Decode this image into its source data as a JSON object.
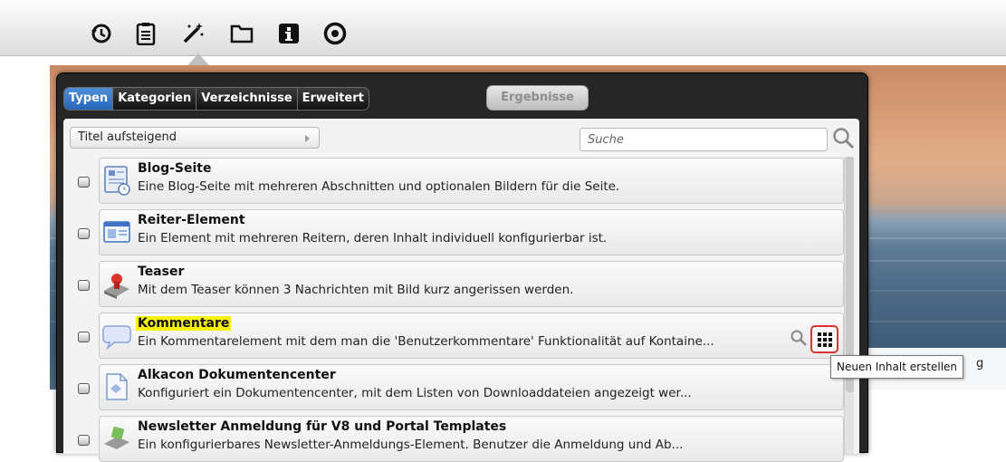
{
  "toolbar": {
    "icons": [
      "history-icon",
      "clipboard-icon",
      "magic-wand-icon",
      "folder-icon",
      "info-icon",
      "target-icon"
    ]
  },
  "dialog": {
    "tabs": [
      {
        "label": "Typen",
        "active": true
      },
      {
        "label": "Kategorien",
        "active": false
      },
      {
        "label": "Verzeichnisse",
        "active": false
      },
      {
        "label": "Erweitert",
        "active": false
      }
    ],
    "results_label": "Ergebnisse",
    "sort_value": "Titel aufsteigend",
    "search_placeholder": "Suche",
    "items": [
      {
        "title": "Blog-Seite",
        "desc": "Eine Blog-Seite mit mehreren Abschnitten und optionalen Bildern für die Seite.",
        "icon": "blog-page-icon"
      },
      {
        "title": "Reiter-Element",
        "desc": "Ein Element mit mehreren Reitern, deren Inhalt individuell konfigurierbar ist.",
        "icon": "tab-element-icon"
      },
      {
        "title": "Teaser",
        "desc": "Mit dem Teaser können 3 Nachrichten mit Bild kurz angerissen werden.",
        "icon": "teaser-icon"
      },
      {
        "title": "Kommentare",
        "desc": "Ein Kommentarelement mit dem man die 'Benutzerkommentare' Funktionalität auf Kontaine...",
        "icon": "comment-bubble-icon",
        "highlighted": true
      },
      {
        "title": "Alkacon Dokumentencenter",
        "desc": "Konfiguriert ein Dokumentencenter, mit dem Listen von Downloaddateien angezeigt wer...",
        "icon": "document-center-icon"
      },
      {
        "title": "Newsletter Anmeldung für V8 und Portal Templates",
        "desc": "Ein konfigurierbares Newsletter-Anmeldungs-Element. Benutzer die Anmeldung und Ab...",
        "icon": "newsletter-icon"
      }
    ],
    "tooltip": "Neuen Inhalt erstellen"
  },
  "background": {
    "caption": "g"
  },
  "colors": {
    "active_tab": "#2566b9",
    "dialog_bg": "#262626",
    "highlight": "#f7f10c",
    "new_button_border": "#e03030"
  }
}
